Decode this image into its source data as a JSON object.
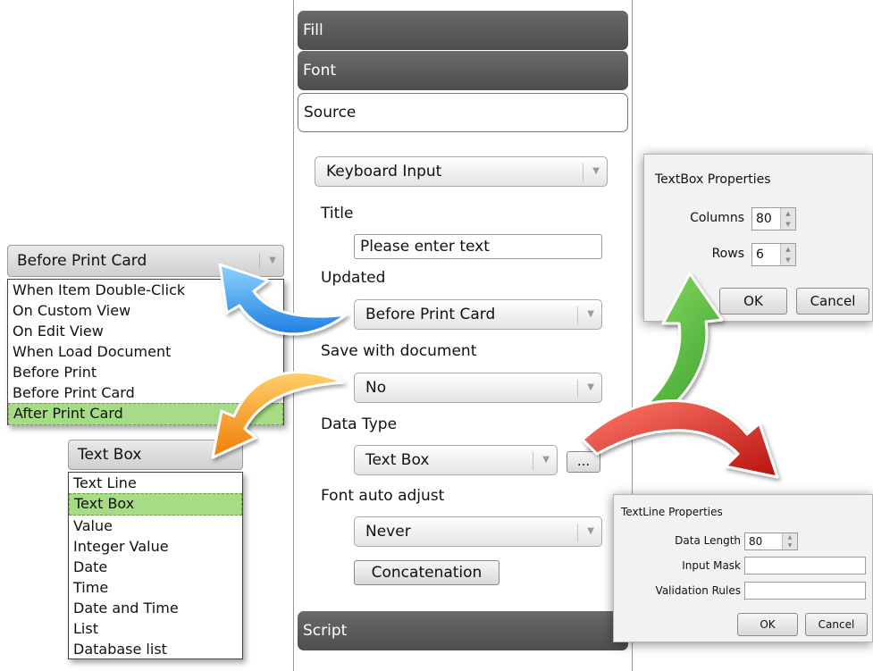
{
  "panel": {
    "sections": {
      "fill": "Fill",
      "font": "Font",
      "source": "Source",
      "script": "Script"
    },
    "source_combo": "Keyboard Input",
    "title_label": "Title",
    "title_value": "Please enter text",
    "updated_label": "Updated",
    "updated_value": "Before Print Card",
    "save_label": "Save with document",
    "save_value": "No",
    "datatype_label": "Data Type",
    "datatype_value": "Text Box",
    "ellipsis": "...",
    "fontauto_label": "Font auto adjust",
    "fontauto_value": "Never",
    "concat_button": "Concatenation"
  },
  "updated_dropdown": {
    "selected": "Before Print Card",
    "items": [
      "When Item Double-Click",
      "On Custom View",
      "On Edit View",
      "When Load Document",
      "Before Print",
      "Before Print Card",
      "After Print Card"
    ],
    "highlighted_index": 6
  },
  "datatype_dropdown": {
    "selected": "Text Box",
    "items": [
      "Text Line",
      "Text Box",
      "Value",
      "Integer Value",
      "Date",
      "Time",
      "Date and Time",
      "List",
      "Database list"
    ],
    "highlighted_index": 1
  },
  "textbox_dialog": {
    "title": "TextBox  Properties",
    "columns_label": "Columns",
    "columns_value": "80",
    "rows_label": "Rows",
    "rows_value": "6",
    "ok": "OK",
    "cancel": "Cancel"
  },
  "textline_dialog": {
    "title": "TextLine  Properties",
    "data_length_label": "Data Length",
    "data_length_value": "80",
    "input_mask_label": "Input Mask",
    "input_mask_value": "",
    "validation_label": "Validation Rules",
    "validation_value": "",
    "ok": "OK",
    "cancel": "Cancel"
  },
  "colors": {
    "arrow_blue": "#1e8fe8",
    "arrow_orange": "#f08a12",
    "arrow_green": "#3aa52a",
    "arrow_red": "#d0201a",
    "selection_green": "#a6dc86",
    "section_bar": "#555555"
  }
}
